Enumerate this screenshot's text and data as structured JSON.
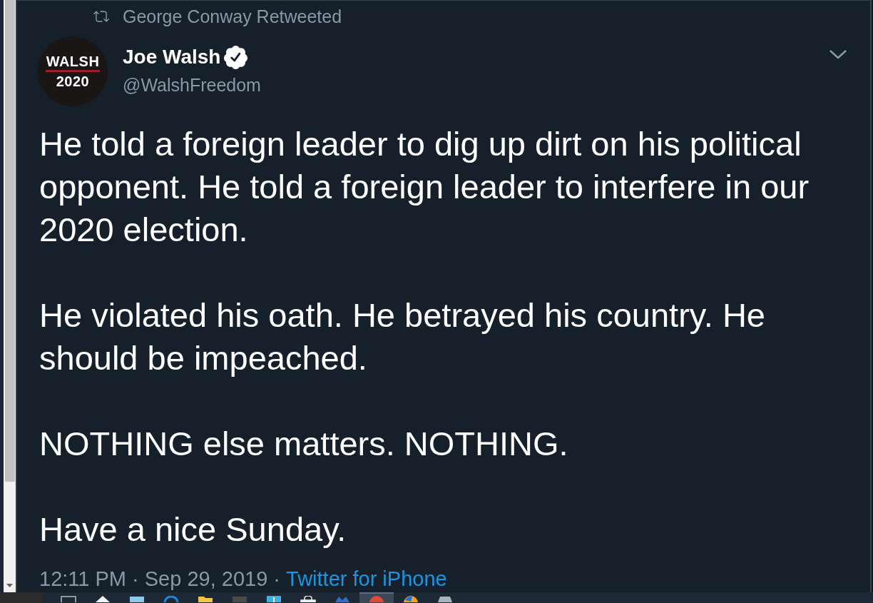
{
  "retweet_header": {
    "text": "George Conway Retweeted"
  },
  "tweet": {
    "avatar": {
      "line_1": "WALSH",
      "line_2": "2020"
    },
    "author": {
      "name": "Joe Walsh",
      "verified": true,
      "handle": "@WalshFreedom"
    },
    "paragraphs": [
      "He told a foreign leader to dig up dirt on his political opponent. He told a foreign leader to interfere in our 2020 election.",
      "He violated his oath. He betrayed his country. He should be impeached.",
      "NOTHING else matters. NOTHING.",
      "Have a nice Sunday."
    ],
    "timestamp": "12:11 PM · Sep 29, 2019 ·",
    "source": "Twitter for iPhone"
  },
  "taskbar": {
    "apps": [
      {
        "kind": "frame",
        "selected": false
      },
      {
        "kind": "house",
        "selected": false
      },
      {
        "kind": "window",
        "selected": false
      },
      {
        "kind": "ring",
        "selected": false
      },
      {
        "kind": "folder",
        "selected": false
      },
      {
        "kind": "bar",
        "selected": false
      },
      {
        "kind": "square",
        "selected": false
      },
      {
        "kind": "bag",
        "selected": false
      },
      {
        "kind": "wave",
        "selected": false
      },
      {
        "kind": "disc",
        "selected": true
      },
      {
        "kind": "globe",
        "selected": false
      },
      {
        "kind": "box",
        "selected": false
      }
    ]
  }
}
